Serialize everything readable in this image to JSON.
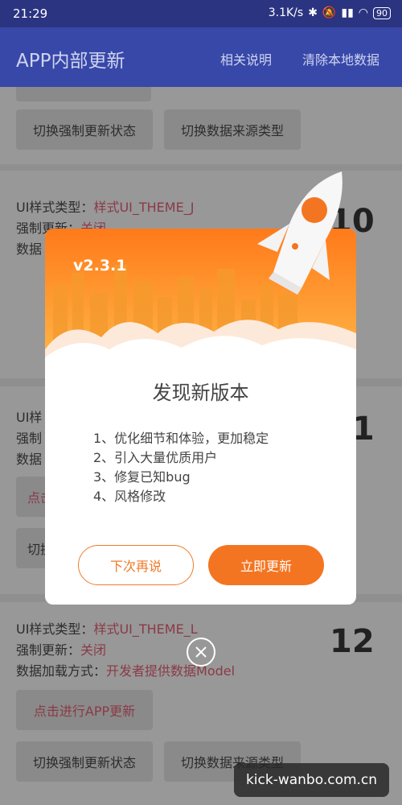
{
  "status_bar": {
    "time": "21:29",
    "network_speed": "3.1K/s",
    "battery": "90"
  },
  "toolbar": {
    "title": "APP内部更新",
    "action_help": "相关说明",
    "action_clear": "清除本地数据"
  },
  "cards": [
    {
      "buttons": [
        "切换强制更新状态",
        "切换数据来源类型"
      ]
    },
    {
      "style_label": "UI样式类型：",
      "style_value": "样式UI_THEME_J",
      "force_label": "强制更新：",
      "force_value": "关闭",
      "data_label": "数据",
      "number": "10"
    },
    {
      "style_label": "UI样",
      "force_label": "强制",
      "data_label": "数据",
      "number": "11",
      "btn_short": "点击",
      "btn_short2": "切换"
    },
    {
      "style_label": "UI样式类型：",
      "style_value": "样式UI_THEME_L",
      "force_label": "强制更新：",
      "force_value": "关闭",
      "data_label": "数据加载方式：",
      "data_value": "开发者提供数据Model",
      "number": "12",
      "btn_update": "点击进行APP更新",
      "buttons": [
        "切换强制更新状态",
        "切换数据来源类型"
      ]
    }
  ],
  "dialog": {
    "version": "v2.3.1",
    "title": "发现新版本",
    "notes": [
      "1、优化细节和体验，更加稳定",
      "2、引入大量优质用户",
      "3、修复已知bug",
      "4、风格修改"
    ],
    "later_label": "下次再说",
    "update_label": "立即更新"
  },
  "watermark": "kick-wanbo.com.cn",
  "colors": {
    "accent": "#f47521",
    "toolbar": "#3848a8",
    "value_text": "#d55a6e"
  }
}
